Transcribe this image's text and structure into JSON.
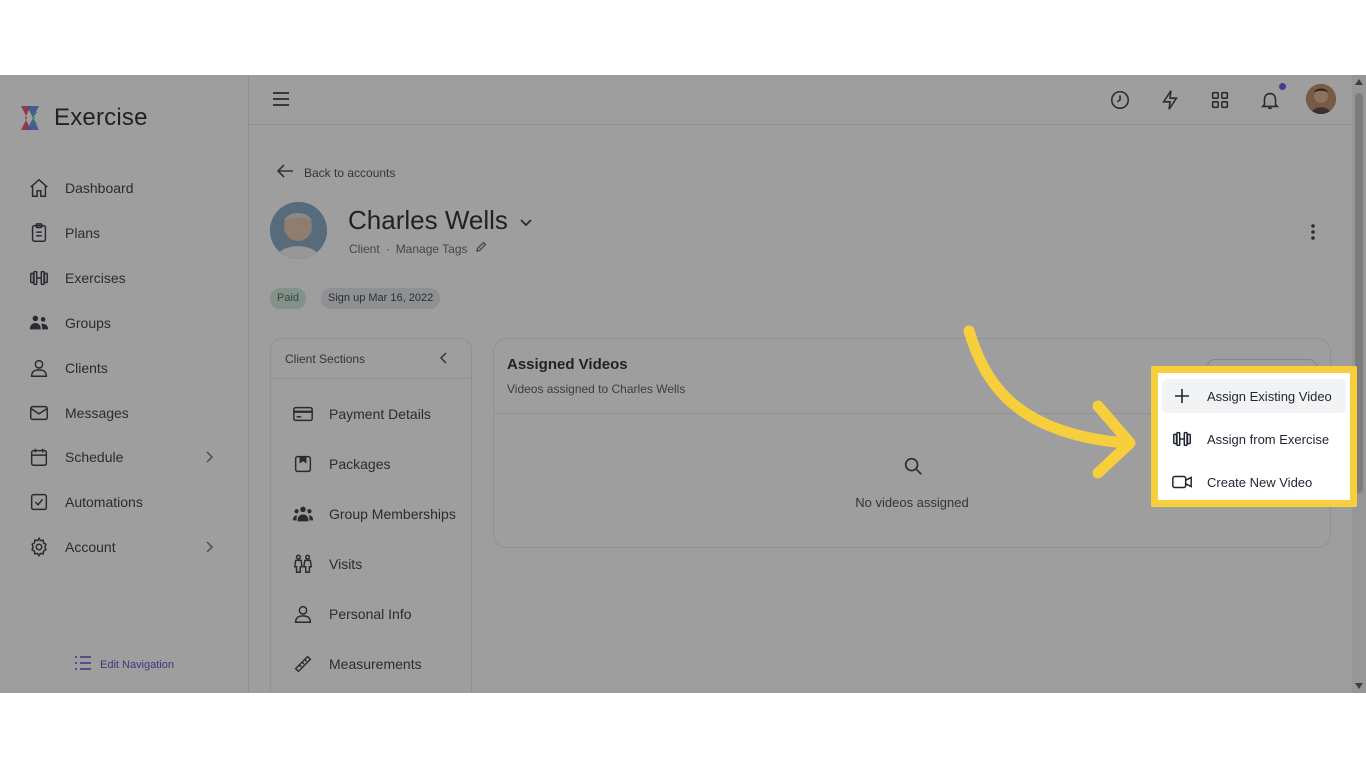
{
  "app": {
    "name": "Exercise"
  },
  "sidebar": {
    "items": [
      {
        "label": "Dashboard",
        "icon": "home-icon"
      },
      {
        "label": "Plans",
        "icon": "clipboard-icon"
      },
      {
        "label": "Exercises",
        "icon": "dumbbell-icon"
      },
      {
        "label": "Groups",
        "icon": "users-icon"
      },
      {
        "label": "Clients",
        "icon": "user-icon"
      },
      {
        "label": "Messages",
        "icon": "mail-icon"
      },
      {
        "label": "Schedule",
        "icon": "calendar-icon",
        "has_submenu": true
      },
      {
        "label": "Automations",
        "icon": "checkbox-icon"
      },
      {
        "label": "Account",
        "icon": "gear-icon",
        "has_submenu": true
      }
    ],
    "edit_navigation": "Edit Navigation"
  },
  "topbar": {
    "icons": [
      "clock-icon",
      "lightning-icon",
      "grid-icon",
      "bell-icon"
    ]
  },
  "page": {
    "back_label": "Back to accounts",
    "client": {
      "name": "Charles Wells",
      "role": "Client",
      "manage_tags": "Manage Tags",
      "badges": {
        "paid": "Paid",
        "signup": "Sign up Mar 16, 2022"
      }
    }
  },
  "client_sections": {
    "title": "Client Sections",
    "items": [
      {
        "label": "Payment Details",
        "icon": "credit-card-icon"
      },
      {
        "label": "Packages",
        "icon": "package-icon"
      },
      {
        "label": "Group Memberships",
        "icon": "users-icon"
      },
      {
        "label": "Visits",
        "icon": "people-icon"
      },
      {
        "label": "Personal Info",
        "icon": "user-icon"
      },
      {
        "label": "Measurements",
        "icon": "ruler-icon"
      }
    ]
  },
  "videos": {
    "title": "Assigned Videos",
    "subtitle": "Videos assigned to Charles Wells",
    "empty_text": "No videos assigned"
  },
  "dropdown": {
    "items": [
      {
        "label": "Assign Existing Video",
        "icon": "plus-icon"
      },
      {
        "label": "Assign from Exercise",
        "icon": "dumbbell-icon"
      },
      {
        "label": "Create New Video",
        "icon": "video-camera-icon"
      }
    ]
  },
  "colors": {
    "accent": "#5b4ee6",
    "highlight": "#f7cf3d",
    "paid_badge": "#cfe8dd"
  }
}
